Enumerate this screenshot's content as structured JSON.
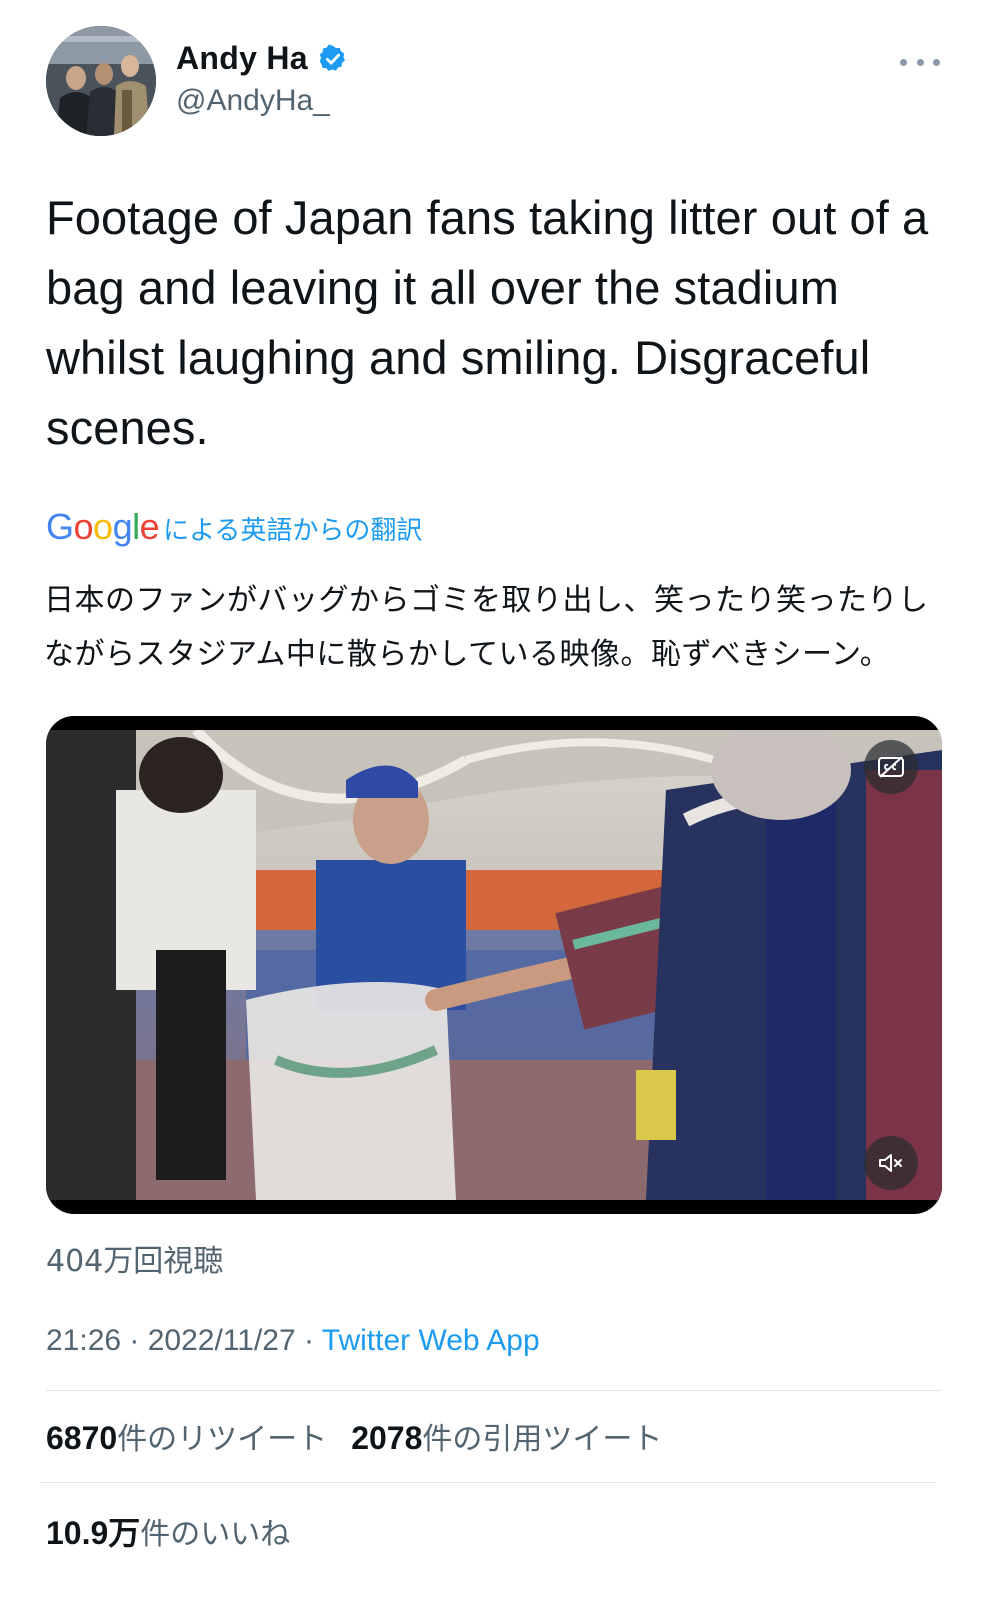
{
  "header": {
    "display_name": "Andy Ha",
    "handle": "@AndyHa_",
    "verified_icon": "verified-badge-icon",
    "more_icon": "more-options-icon"
  },
  "tweet": {
    "text_lines": [
      "Footage of Japan fans taking litter out of a",
      "bag and leaving it all over the stadium",
      "whilst laughing and smiling. Disgraceful",
      "scenes."
    ]
  },
  "translation": {
    "provider_logo_text": "Google",
    "label": "による英語からの翻訳",
    "text_lines": [
      "日本のファンがバッグからゴミを取り出し、笑ったり笑ったりし",
      "ながらスタジアム中に散らかしている映像。恥ずべきシーン。"
    ]
  },
  "video": {
    "captions_icon": "closed-captions-off-icon",
    "mute_icon": "speaker-muted-icon",
    "views": "404万回視聴"
  },
  "meta": {
    "time": "21:26",
    "date": "2022/11/27",
    "separator": " · ",
    "source": "Twitter Web App"
  },
  "stats": {
    "retweets_count": "6870",
    "retweets_label": "件のリツイート",
    "quotes_count": "2078",
    "quotes_label": "件の引用ツイート",
    "likes_count": "10.9万",
    "likes_label": "件のいいね"
  },
  "colors": {
    "accent": "#1d9bf0",
    "secondary_text": "#536471",
    "primary_text": "#0f1419"
  }
}
